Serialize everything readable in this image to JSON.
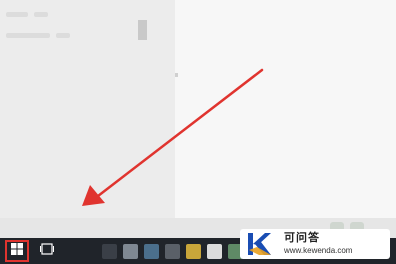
{
  "taskbar": {
    "start_icon": "windows-logo-icon",
    "taskview_icon": "task-view-icon",
    "pinned_apps": [
      {
        "name": "app-1",
        "color": "#3a3f47"
      },
      {
        "name": "app-2",
        "color": "#7f8892"
      },
      {
        "name": "app-3",
        "color": "#4b6f8c"
      },
      {
        "name": "app-4",
        "color": "#5a6068"
      },
      {
        "name": "app-5",
        "color": "#c9a63a"
      },
      {
        "name": "app-6",
        "color": "#dcdcdc"
      },
      {
        "name": "app-7",
        "color": "#5f8a66"
      }
    ]
  },
  "annotation": {
    "arrow_color": "#e0342f",
    "highlight_color": "#e0342f"
  },
  "watermark": {
    "title": "可问答",
    "url": "www.kewenda.com",
    "brand_color": "#1a4db3",
    "accent_color": "#e8a020"
  }
}
